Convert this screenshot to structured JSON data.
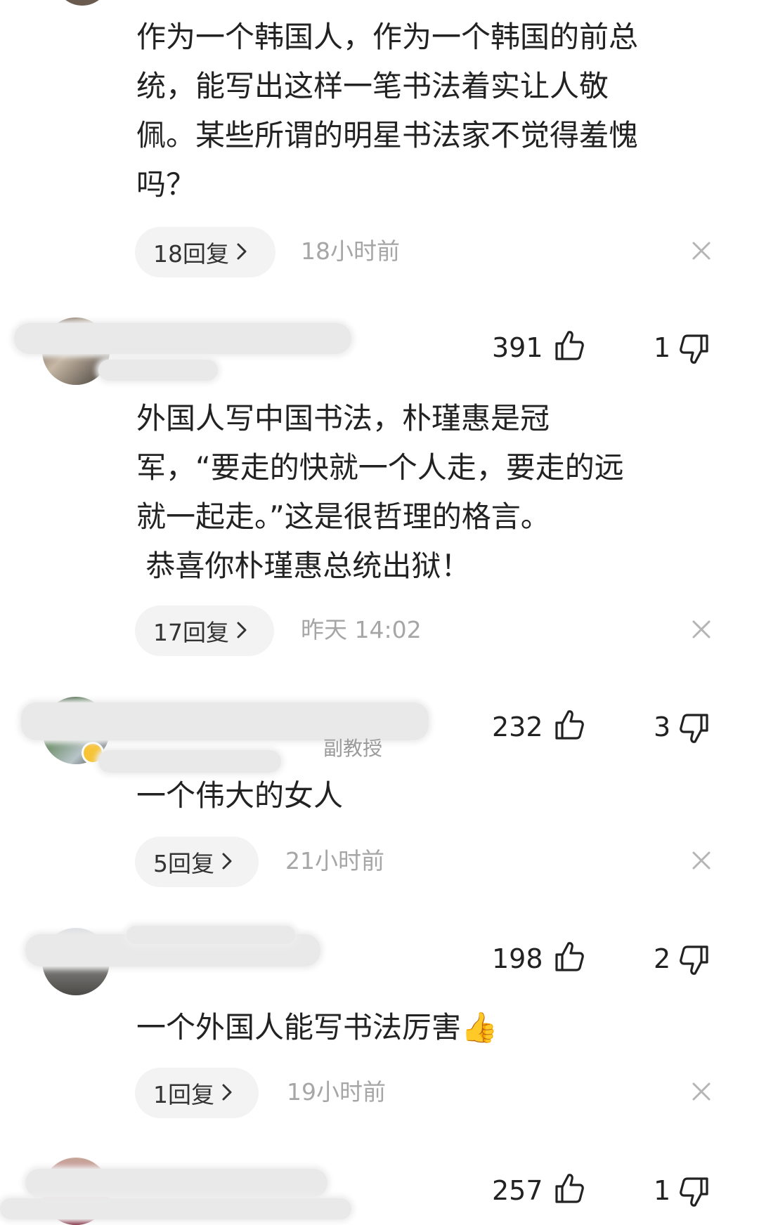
{
  "comments": [
    {
      "text": "作为一个韩国人，作为一个韩国的前总\n统，能写出这样一笔书法着实让人敬\n佩。某些所谓的明星书法家不觉得羞愧\n吗？",
      "replies": "18回复",
      "time": "18小时前"
    },
    {
      "likes": "391",
      "dislikes": "1",
      "text": "外国人写中国书法，朴瑾惠是冠\n军，“要走的快就一个人走，要走的远\n就一起走。”这是很哲理的格言。\n 恭喜你朴瑾惠总统出狱！",
      "replies": "17回复",
      "time": "昨天  14:02"
    },
    {
      "likes": "232",
      "dislikes": "3",
      "subtitle": "副教授",
      "text": "一个伟大的女人",
      "replies": "5回复",
      "time": "21小时前"
    },
    {
      "likes": "198",
      "dislikes": "2",
      "text": "一个外国人能写书法厉害👍",
      "replies": "1回复",
      "time": "19小时前"
    },
    {
      "likes": "257",
      "dislikes": "1"
    }
  ],
  "icons": {
    "like": "thumbs-up-outline",
    "dislike": "thumbs-down-outline",
    "close": "x-mark",
    "chevron": "chevron-right"
  },
  "colors": {
    "text": "#222222",
    "muted": "#a6a6a6",
    "pill": "#f3f3f3"
  }
}
